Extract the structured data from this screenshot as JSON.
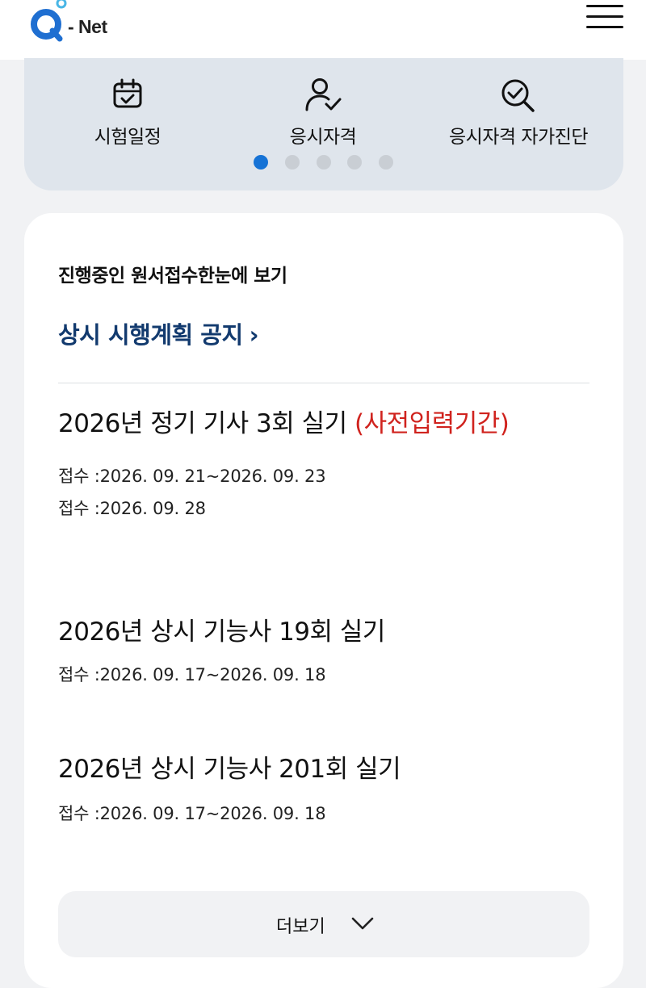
{
  "header": {
    "logo_text": "- Net",
    "icons": {
      "logo": "q-net-logo",
      "menu": "hamburger-menu-icon"
    }
  },
  "quick_menu": {
    "items": [
      {
        "label": "시험일정",
        "icon": "calendar-check-icon"
      },
      {
        "label": "응시자격",
        "icon": "user-check-icon"
      },
      {
        "label": "응시자격 자가진단",
        "icon": "magnifier-check-icon"
      }
    ],
    "pagination": {
      "total": 5,
      "active": 1
    }
  },
  "application": {
    "section_title": "진행중인 원서접수한눈에 보기",
    "notice_link": "상시 시행계획 공지",
    "notice_chevron": "›",
    "exams": [
      {
        "title": "2026년 정기 기사 3회 실기 ",
        "highlight": "(사전입력기간)",
        "dates": [
          "접수 :2026. 09. 21~2026. 09. 23",
          "접수 :2026. 09. 28"
        ]
      },
      {
        "title": "2026년 상시 기능사 19회 실기",
        "dates": [
          "접수 :2026. 09. 17~2026. 09. 18"
        ]
      },
      {
        "title": "2026년 상시 기능사 201회 실기",
        "dates": [
          "접수 :2026. 09. 17~2026. 09. 18"
        ]
      }
    ],
    "more_label": "더보기"
  },
  "colors": {
    "accent_blue": "#1673d6",
    "link_navy": "#123a6e",
    "highlight_red": "#d0231e",
    "quick_bg": "#dfe5ec",
    "page_bg": "#f1f2f4"
  }
}
